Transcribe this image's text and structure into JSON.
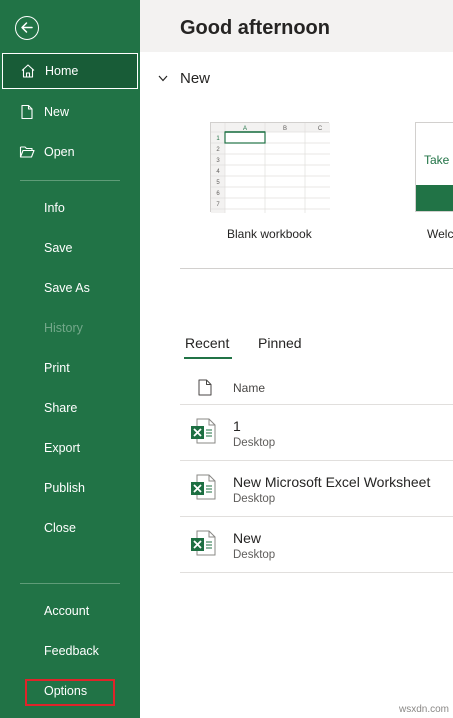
{
  "sidebar": {
    "back_icon": "arrow-left-icon",
    "home": "Home",
    "new": "New",
    "open": "Open",
    "info": "Info",
    "save": "Save",
    "save_as": "Save As",
    "history": "History",
    "print": "Print",
    "share": "Share",
    "export": "Export",
    "publish": "Publish",
    "close": "Close",
    "account": "Account",
    "feedback": "Feedback",
    "options": "Options",
    "bg_color": "#217346",
    "selected_bg": "#185c37",
    "highlight_color": "#e0242a"
  },
  "main": {
    "greeting": "Good afternoon",
    "new_section": "New",
    "templates": [
      {
        "label": "Blank workbook",
        "col_headers": [
          "A",
          "B",
          "C"
        ],
        "row_numbers": [
          "1",
          "2",
          "3",
          "4",
          "5",
          "6",
          "7"
        ]
      },
      {
        "label": "Welc",
        "preview_text": "Take a"
      }
    ],
    "tabs": [
      "Recent",
      "Pinned"
    ],
    "active_tab": "Recent",
    "list_header": "Name",
    "files": [
      {
        "name": "1",
        "location": "Desktop"
      },
      {
        "name": "New Microsoft Excel Worksheet",
        "location": "Desktop"
      },
      {
        "name": "New",
        "location": "Desktop"
      }
    ]
  },
  "watermark": "wsxdn.com"
}
